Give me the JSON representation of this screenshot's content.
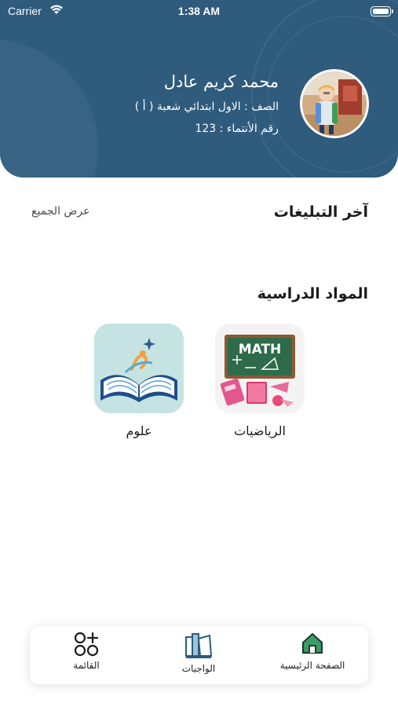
{
  "status_bar": {
    "carrier": "Carrier",
    "time": "1:38 AM",
    "wifi_icon": "wifi-icon",
    "battery_icon": "battery-icon"
  },
  "profile": {
    "name": "محمد كريم عادل",
    "class_line": "الصف : الاول ابتدائي شعبة ( أ )",
    "id_line": "رقم الأنتماء : 123",
    "avatar_icon": "student-photo"
  },
  "announcements": {
    "title": "آخر التبليغات",
    "view_all": "عرض الجميع"
  },
  "subjects": {
    "title": "المواد الدراسية",
    "items": [
      {
        "label": "الرياضيات",
        "image_text": "MATH",
        "icon": "math-board-image"
      },
      {
        "label": "علوم",
        "icon": "open-book-image"
      }
    ]
  },
  "bottom_nav": {
    "items": [
      {
        "label": "الصفحة الرئيسية",
        "icon": "home-icon"
      },
      {
        "label": "الواجبات",
        "icon": "books-icon"
      },
      {
        "label": "القائمة",
        "icon": "grid-plus-icon"
      }
    ]
  },
  "colors": {
    "header": "#2f5b7d",
    "home_icon": "#2f8f5e",
    "background": "#ffffff"
  }
}
